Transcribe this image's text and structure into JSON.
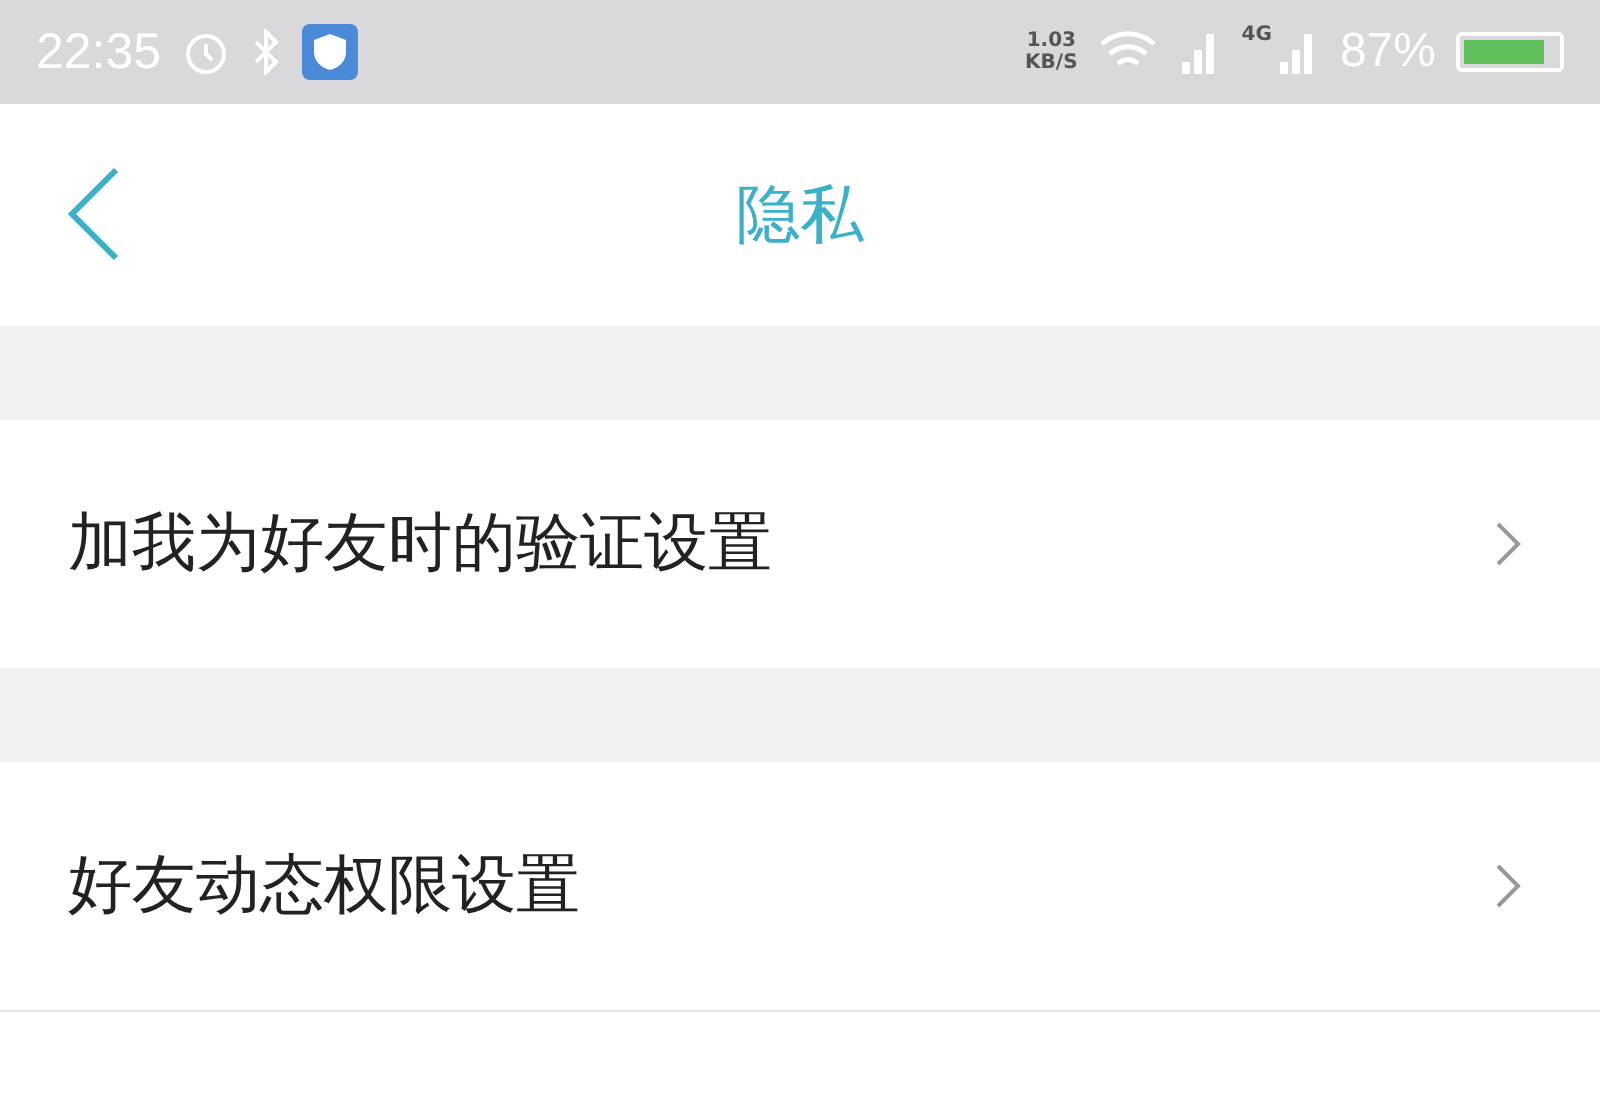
{
  "status_bar": {
    "time": "22:35",
    "speed_value": "1.03",
    "speed_unit": "KB/S",
    "network": "4G",
    "battery": "87%",
    "battery_meter": {
      "level": 0.87
    }
  },
  "header": {
    "title": "隐私"
  },
  "items": [
    {
      "label": "加我为好友时的验证设置"
    },
    {
      "label": "好友动态权限设置"
    }
  ]
}
